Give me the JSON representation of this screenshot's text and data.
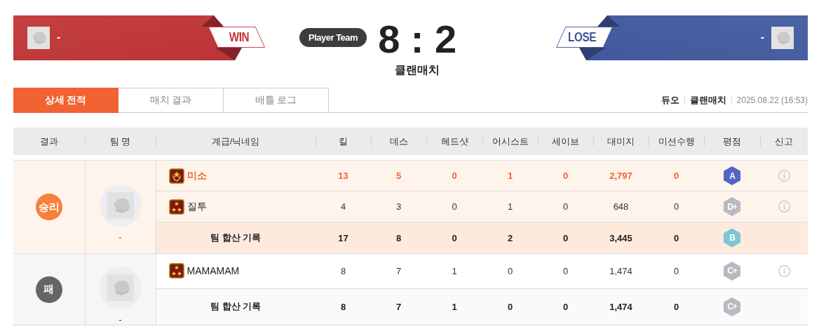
{
  "header": {
    "left_team": {
      "kind": "win",
      "name": "-",
      "outcome": "WIN"
    },
    "center": {
      "team_label": "Player Team",
      "score": "8 : 2",
      "mode": "클랜매치"
    },
    "right_team": {
      "kind": "lose",
      "name": "-",
      "outcome": "LOSE"
    }
  },
  "tabs": [
    {
      "label": "상세 전적",
      "selected": true
    },
    {
      "label": "매치 결과",
      "selected": false
    },
    {
      "label": "배틀 로그",
      "selected": false
    }
  ],
  "match_info": {
    "tags": [
      "듀오",
      "클랜매치"
    ],
    "date": "2025.08.22 (16:53)"
  },
  "table": {
    "columns": [
      "결과",
      "팀 명",
      "계급/닉네임",
      "킬",
      "데스",
      "헤드샷",
      "어시스트",
      "세이브",
      "대미지",
      "미션수행",
      "평점",
      "신고"
    ],
    "teams": [
      {
        "kind": "win",
        "result": "승리",
        "team_name": "-",
        "players": [
          {
            "kind": "laurel",
            "nickname": "미소",
            "highlighted": true,
            "stats": [
              "13",
              "5",
              "0",
              "1",
              "0",
              "2,797",
              "0"
            ],
            "grade": {
              "letter": "A",
              "color": "#5565c5"
            }
          },
          {
            "kind": "stars",
            "nickname": "질투",
            "highlighted": false,
            "stats": [
              "4",
              "3",
              "0",
              "1",
              "0",
              "648",
              "0"
            ],
            "grade": {
              "letter": "D+",
              "color": "#b9b9c1"
            }
          }
        ],
        "total": {
          "label": "팀 합산 기록",
          "stats": [
            "17",
            "8",
            "0",
            "2",
            "0",
            "3,445",
            "0"
          ],
          "grade": {
            "letter": "B",
            "color": "#7ec6d2"
          }
        }
      },
      {
        "kind": "lose",
        "result": "패",
        "team_name": "-",
        "players": [
          {
            "kind": "stars",
            "nickname": "MAMAMAM",
            "highlighted": false,
            "stats": [
              "8",
              "7",
              "1",
              "0",
              "0",
              "1,474",
              "0"
            ],
            "grade": {
              "letter": "C+",
              "color": "#b9b9c1"
            }
          }
        ],
        "total": {
          "label": "팀 합산 기록",
          "stats": [
            "8",
            "7",
            "1",
            "0",
            "0",
            "1,474",
            "0"
          ],
          "grade": {
            "letter": "C+",
            "color": "#b9b9c1"
          }
        }
      }
    ]
  }
}
